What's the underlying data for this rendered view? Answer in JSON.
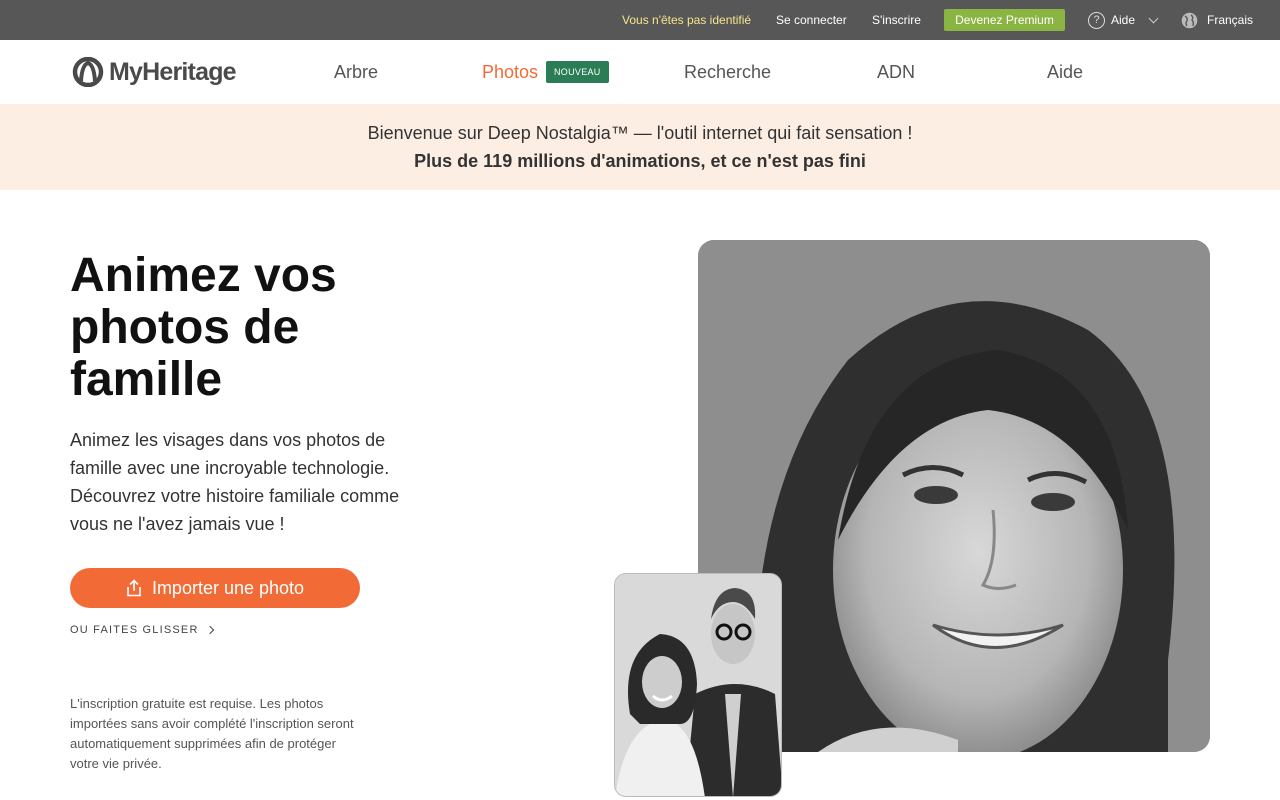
{
  "topbar": {
    "guest_text": "Vous n'êtes pas identifié",
    "login": "Se connecter",
    "signup": "S'inscrire",
    "premium": "Devenez Premium",
    "help": "Aide",
    "language": "Français"
  },
  "nav": {
    "logo": "MyHeritage",
    "items": [
      {
        "label": "Arbre"
      },
      {
        "label": "Photos",
        "badge": "NOUVEAU"
      },
      {
        "label": "Recherche"
      },
      {
        "label": "ADN"
      },
      {
        "label": "Aide"
      }
    ]
  },
  "banner": {
    "line1": "Bienvenue sur Deep Nostalgia™ — l'outil internet qui fait sensation !",
    "line2": "Plus de 119 millions d'animations, et ce n'est pas fini"
  },
  "hero": {
    "title": "Animez vos photos de famille",
    "description": "Animez les visages dans vos photos de famille avec une incroyable technologie. Découvrez votre histoire familiale comme vous ne l'avez jamais vue !",
    "upload_button": "Importer une photo",
    "drag_text": "OU FAITES GLISSER",
    "note": "L'inscription gratuite est requise. Les photos importées sans avoir complété l'inscription seront automatiquement supprimées afin de protéger votre vie privée."
  },
  "colors": {
    "accent": "#f26b37",
    "premium": "#8ab542",
    "badge": "#2a7d55",
    "topbar": "#575757",
    "banner": "#fdeee4"
  }
}
